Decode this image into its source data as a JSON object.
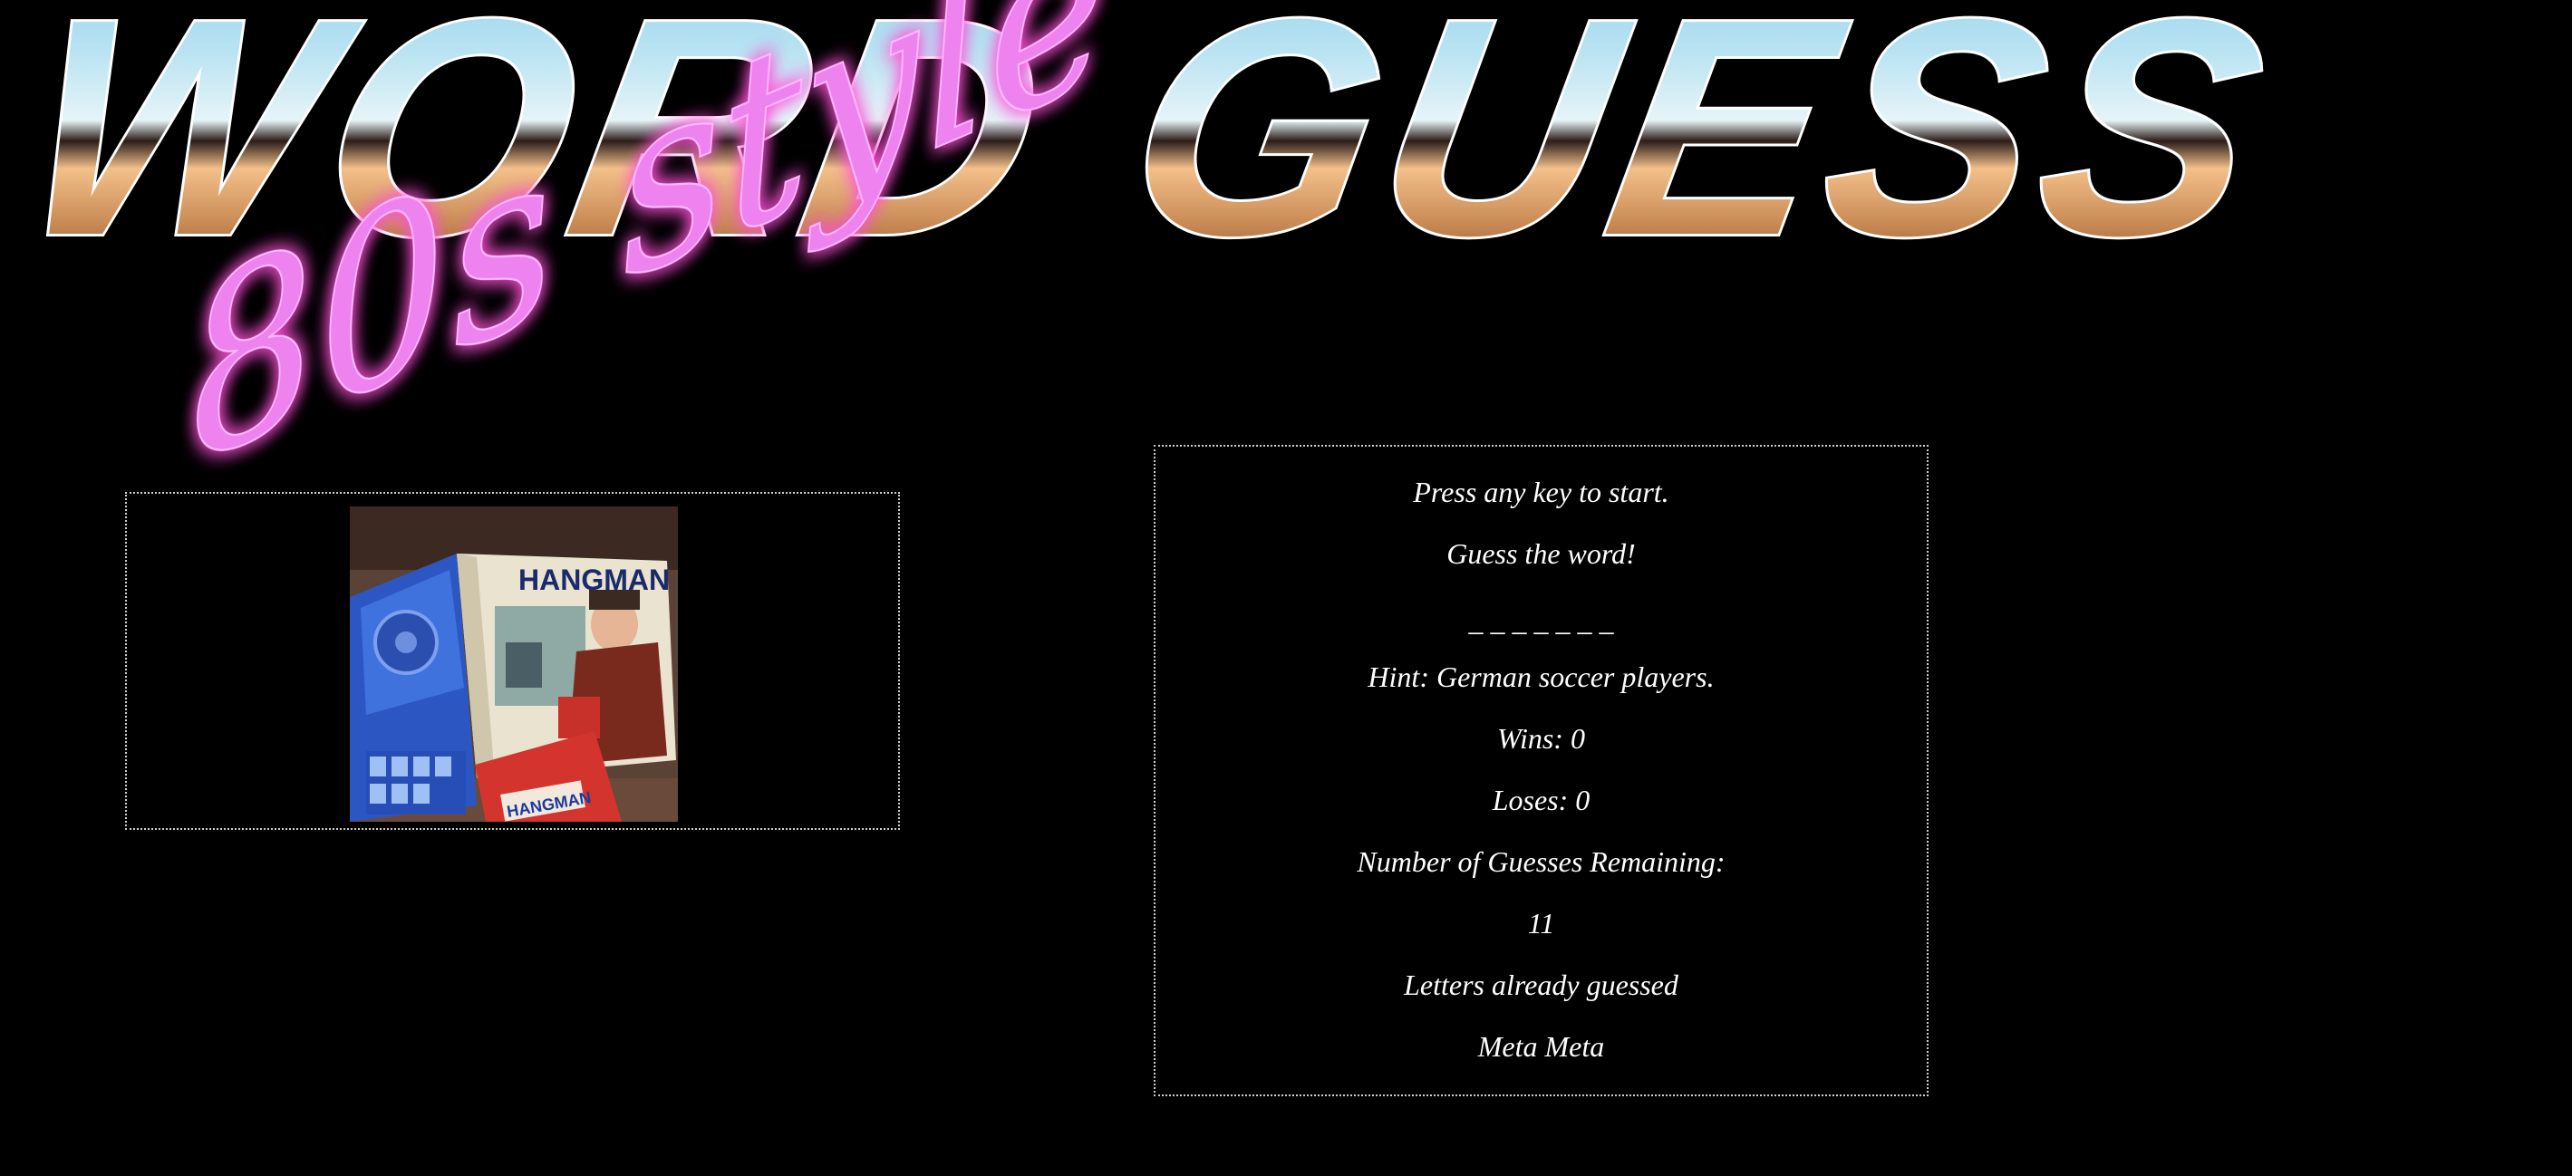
{
  "header": {
    "title": "WORD GUESS",
    "subtitle": "80s style"
  },
  "game": {
    "start_prompt": "Press any key to start.",
    "instruction": "Guess the word!",
    "word_blanks": "_ _ _ _ _ _ _",
    "hint": "Hint: German soccer players.",
    "wins": "Wins: 0",
    "loses": "Loses: 0",
    "guesses_label": "Number of Guesses Remaining:",
    "guesses_value": "11",
    "letters_label": "Letters already guessed",
    "letters_value": "Meta Meta"
  },
  "image": {
    "box_title": "HANGMAN",
    "card_title": "HANGMAN"
  },
  "colors": {
    "background": "#000000",
    "neon": "#ee82ee",
    "panel_border": "#cfcfcf"
  }
}
